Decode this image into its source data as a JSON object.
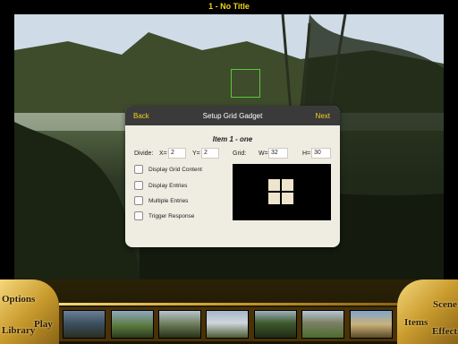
{
  "window": {
    "title": "1 - No Title"
  },
  "dialog": {
    "back_label": "Back",
    "title": "Setup Grid Gadget",
    "next_label": "Next",
    "item_title": "Item 1 - one",
    "divide_label": "Divide:",
    "x_label": "X=",
    "x_value": "2",
    "y_label": "Y=",
    "y_value": "2",
    "grid_label": "Grid:",
    "w_label": "W=",
    "w_value": "32",
    "h_label": "H=",
    "h_value": "30",
    "options": [
      {
        "label": "Display Grid Content",
        "checked": false
      },
      {
        "label": "Display Entries",
        "checked": false
      },
      {
        "label": "Multiple Entries",
        "checked": false
      },
      {
        "label": "Trigger Response",
        "checked": false
      }
    ]
  },
  "toolbar": {
    "options_label": "Options",
    "library_label": "Library",
    "play_label": "Play",
    "items_label": "Items",
    "scene_label": "Scene",
    "effects_label": "Effects"
  },
  "colors": {
    "accent": "#f2d21b",
    "selection": "#59c83a",
    "bar_gold": "#c99b2e"
  }
}
